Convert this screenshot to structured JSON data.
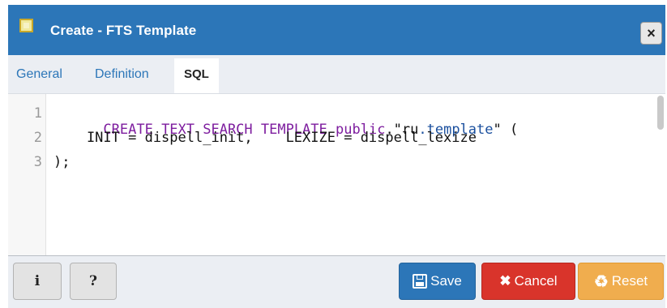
{
  "window": {
    "title": "Create - FTS Template",
    "close_label": "×"
  },
  "tabs": [
    {
      "label": "General"
    },
    {
      "label": "Definition"
    },
    {
      "label": "SQL"
    }
  ],
  "editor": {
    "line_numbers": [
      "1",
      "2",
      "3"
    ],
    "lines": [
      [
        "CREATE TEXT SEARCH TEMPLATE",
        " ",
        "public",
        ".\"ru",
        ".template",
        "\" ("
      ],
      [
        "    INIT = dispell_init,    LEXIZE = dispell_lexize"
      ],
      [
        "); "
      ]
    ]
  },
  "footer": {
    "info_label": "i",
    "help_label": "?",
    "save_label": "Save",
    "cancel_label": "Cancel",
    "reset_label": "Reset"
  },
  "icons": {
    "title": "fts-template-icon",
    "save": "floppy-disk-icon",
    "cancel": "x-icon",
    "reset": "recycle-icon"
  },
  "colors": {
    "header": "#2c76b8",
    "save": "#2c76b8",
    "cancel": "#d9342b",
    "reset": "#f0ad4e",
    "keyword": "#7e1e9f",
    "identifier": "#1a4f9e"
  }
}
